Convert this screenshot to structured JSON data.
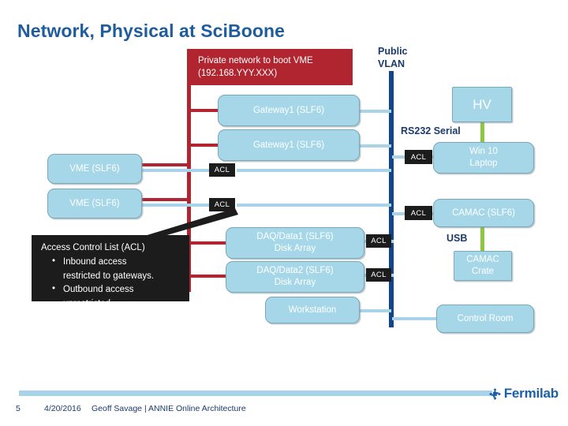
{
  "slide": {
    "title": "Network, Physical at SciBoone",
    "page_number": "5",
    "date": "4/20/2016",
    "footer_text": "Geoff Savage | ANNIE Online Architecture",
    "logo_text": "Fermilab"
  },
  "colors": {
    "title_blue": "#1f5c9e",
    "private_red": "#b02530",
    "public_vlan_blue": "#12468c",
    "node_fill": "#a6d7e8",
    "node_border": "#7ba7b8",
    "link_light_blue": "#a8d3e8",
    "usb_green": "#8ec63f",
    "acl_black": "#1c1c1c"
  },
  "networks": {
    "private": {
      "line1": "Private network to boot VME",
      "line2": "(192.168.YYY.XXX)"
    },
    "public_vlan": {
      "line1": "Public",
      "line2": "VLAN"
    },
    "rs232_label": "RS232 Serial",
    "usb_label": "USB"
  },
  "acl_callout": {
    "header": "Access Control List (ACL)",
    "bullets": [
      "Inbound access restricted to gateways.",
      "Outbound access unrestricted."
    ],
    "bullet1_line1": "Inbound access",
    "bullet1_line2": "restricted to gateways.",
    "bullet2_line1": "Outbound access",
    "bullet2_line2": "unrestricted."
  },
  "acl_chips": [
    {
      "label": "ACL"
    },
    {
      "label": "ACL"
    },
    {
      "label": "ACL"
    },
    {
      "label": "ACL"
    },
    {
      "label": "ACL"
    },
    {
      "label": "ACL"
    }
  ],
  "nodes": {
    "gateway1": {
      "line1": "Gateway1 (SLF6)",
      "line2": ""
    },
    "gateway2": {
      "line1": "Gateway1 (SLF6)",
      "line2": ""
    },
    "vme1": {
      "line1": "VME (SLF6)",
      "line2": ""
    },
    "vme2": {
      "line1": "VME (SLF6)",
      "line2": ""
    },
    "daq1": {
      "line1": "DAQ/Data1 (SLF6)",
      "line2": "Disk Array"
    },
    "daq2": {
      "line1": "DAQ/Data2 (SLF6)",
      "line2": "Disk Array"
    },
    "workstation": {
      "line1": "Workstation",
      "line2": ""
    },
    "hv": {
      "line1": "HV",
      "line2": ""
    },
    "win10": {
      "line1": "Win 10",
      "line2": "Laptop"
    },
    "camac": {
      "line1": "CAMAC (SLF6)",
      "line2": ""
    },
    "camac_crate": {
      "line1": "CAMAC",
      "line2": "Crate"
    },
    "control_room": {
      "line1": "Control Room",
      "line2": ""
    }
  }
}
